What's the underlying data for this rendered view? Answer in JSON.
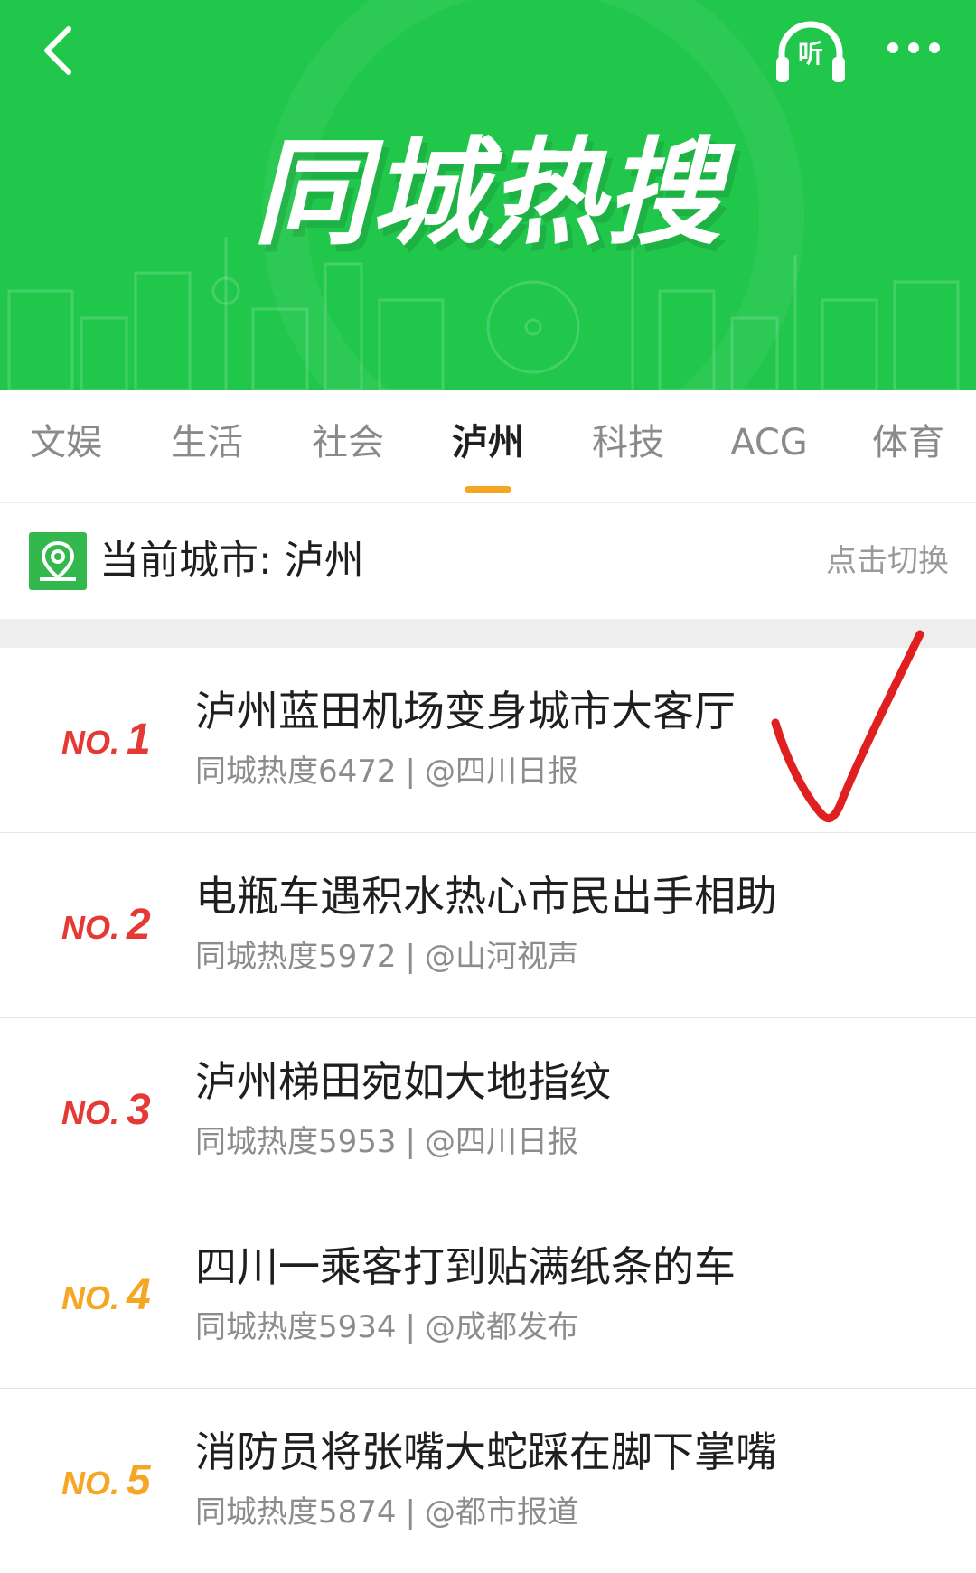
{
  "header": {
    "title": "同城热搜",
    "listen_label": "听",
    "icons": {
      "back": "chevron-left-icon",
      "listen": "headphones-icon",
      "more": "more-dots-icon"
    },
    "colors": {
      "banner": "#21c74b",
      "text": "#ffffff"
    }
  },
  "tabs": {
    "items": [
      "文娱",
      "生活",
      "社会",
      "泸州",
      "科技",
      "ACG",
      "体育"
    ],
    "active": "泸州",
    "underline_color": "#f5a623"
  },
  "city": {
    "label": "当前城市: 泸州",
    "switch_label": "点击切换",
    "icon": "location-pin-icon"
  },
  "hot_list": [
    {
      "rank_prefix": "NO.",
      "rank": "1",
      "title": "泸州蓝田机场变身城市大客厅",
      "heat": "同城热度6472",
      "sep": "|",
      "source": "@四川日报",
      "rank_color": "#e53935"
    },
    {
      "rank_prefix": "NO.",
      "rank": "2",
      "title": "电瓶车遇积水热心市民出手相助",
      "heat": "同城热度5972",
      "sep": "|",
      "source": "@山河视声",
      "rank_color": "#e53935"
    },
    {
      "rank_prefix": "NO.",
      "rank": "3",
      "title": "泸州梯田宛如大地指纹",
      "heat": "同城热度5953",
      "sep": "|",
      "source": "@四川日报",
      "rank_color": "#e53935"
    },
    {
      "rank_prefix": "NO.",
      "rank": "4",
      "title": "四川一乘客打到贴满纸条的车",
      "heat": "同城热度5934",
      "sep": "|",
      "source": "@成都发布",
      "rank_color": "#f5a623"
    },
    {
      "rank_prefix": "NO.",
      "rank": "5",
      "title": "消防员将张嘴大蛇踩在脚下掌嘴",
      "heat": "同城热度5874",
      "sep": "|",
      "source": "@都市报道",
      "rank_color": "#f5a623"
    }
  ],
  "annotation": {
    "icon": "red-checkmark-icon",
    "color": "#e02020"
  }
}
